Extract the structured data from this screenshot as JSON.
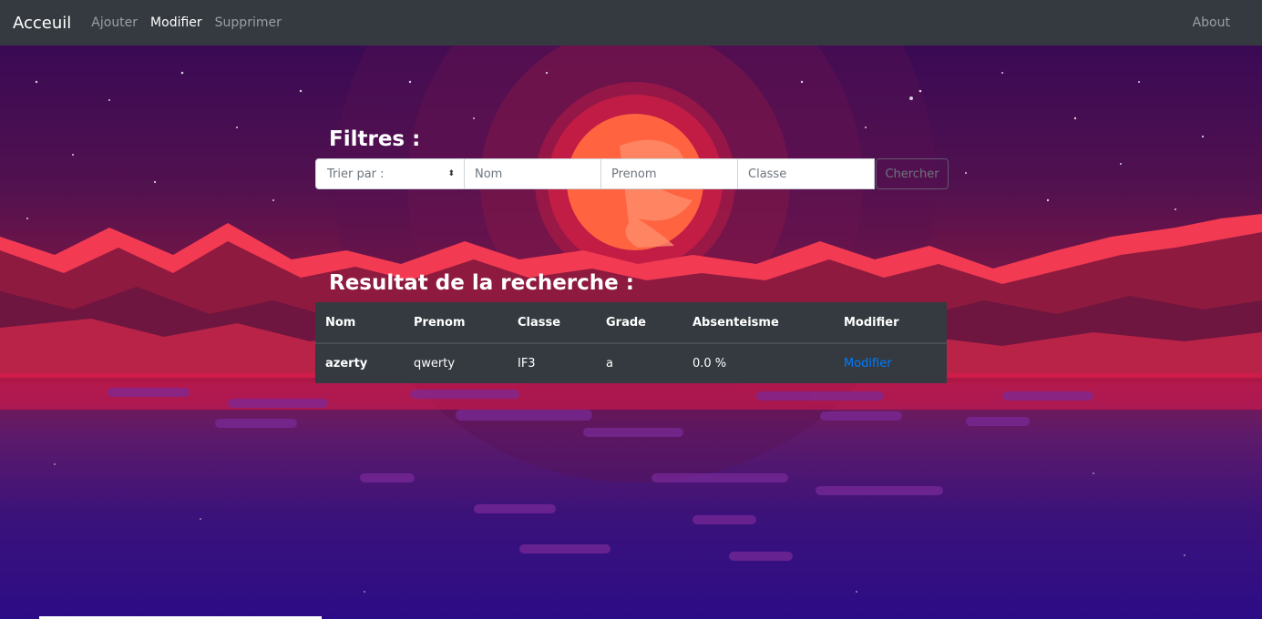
{
  "navbar": {
    "brand": "Acceuil",
    "links": [
      {
        "label": "Ajouter",
        "active": false
      },
      {
        "label": "Modifier",
        "active": true
      },
      {
        "label": "Supprimer",
        "active": false
      }
    ],
    "right_link": "About"
  },
  "filters": {
    "heading": "Filtres :",
    "sort_select": "Trier par :",
    "nom_placeholder": "Nom",
    "prenom_placeholder": "Prenom",
    "classe_placeholder": "Classe",
    "search_button": "Chercher"
  },
  "results": {
    "heading": "Resultat de la recherche :",
    "columns": [
      "Nom",
      "Prenom",
      "Classe",
      "Grade",
      "Absenteisme",
      "Modifier"
    ],
    "rows": [
      {
        "nom": "azerty",
        "prenom": "qwerty",
        "classe": "IF3",
        "grade": "a",
        "absenteisme": "0.0 %",
        "action": "Modifier"
      }
    ]
  },
  "colors": {
    "navbar": "#343a40",
    "link_accent": "#007bff",
    "table_bg": "#343a40"
  }
}
